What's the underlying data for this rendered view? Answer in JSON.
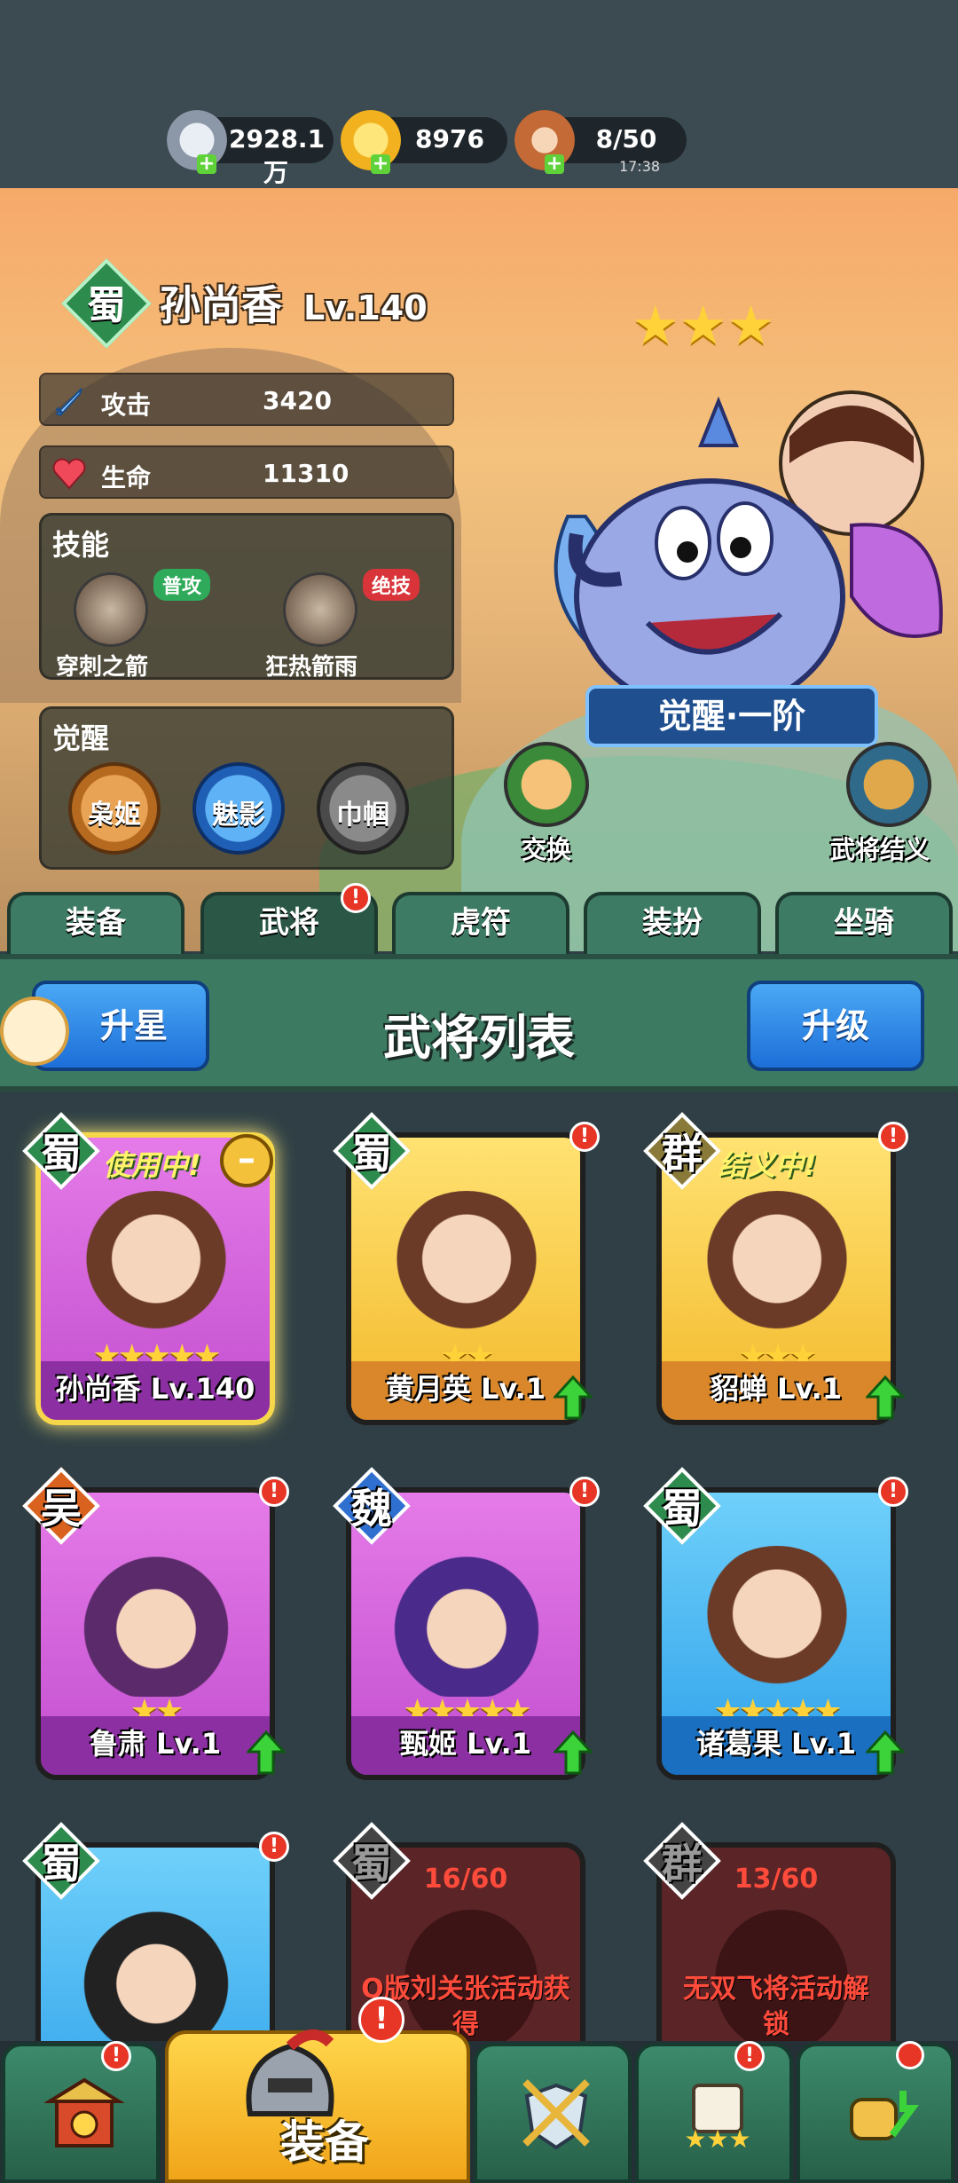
{
  "resources": {
    "silver": "2928.1万",
    "gold": "8976",
    "stamina": "8/50",
    "stamina_timer": "17:38",
    "plus": "+"
  },
  "hero": {
    "kingdom": "蜀",
    "name": "孙尚香",
    "level": "Lv.140",
    "stars": 5,
    "stats": [
      {
        "label": "攻击",
        "value": "3420"
      },
      {
        "label": "生命",
        "value": "11310"
      }
    ],
    "skills_title": "技能",
    "skills": [
      {
        "name": "穿刺之箭",
        "tag": "普攻"
      },
      {
        "name": "狂热箭雨",
        "tag": "绝技"
      }
    ],
    "awaken_title": "觉醒",
    "awakenings": [
      "枭姬",
      "魅影",
      "巾帼"
    ],
    "awaken_stage": "觉醒·一阶",
    "swap_label": "交换",
    "sworn_label": "武将结义"
  },
  "tabs": [
    "装备",
    "武将",
    "虎符",
    "装扮",
    "坐骑"
  ],
  "badge_mark": "!",
  "list": {
    "title": "武将列表",
    "star_up": "升星",
    "level_up": "升级"
  },
  "cards": [
    {
      "kingdom": "蜀",
      "name": "孙尚香",
      "level": "Lv.140",
      "stars": "★★★★★",
      "status": "使用中!",
      "label": "孙尚香 Lv.140"
    },
    {
      "kingdom": "蜀",
      "name": "黄月英",
      "level": "Lv.1",
      "stars": "★★",
      "label": "黄月英 Lv.1"
    },
    {
      "kingdom": "群",
      "name": "貂蝉",
      "level": "Lv.1",
      "stars": "★★★",
      "status": "结义中!",
      "label": "貂蝉 Lv.1"
    },
    {
      "kingdom": "吴",
      "name": "鲁肃",
      "level": "Lv.1",
      "stars": "★★",
      "label": "鲁肃 Lv.1"
    },
    {
      "kingdom": "魏",
      "name": "甄姬",
      "level": "Lv.1",
      "stars": "★★★★★",
      "label": "甄姬 Lv.1"
    },
    {
      "kingdom": "蜀",
      "name": "诸葛果",
      "level": "Lv.1",
      "stars": "★★★★★",
      "label": "诸葛果 Lv.1"
    },
    {
      "kingdom": "蜀",
      "name": "",
      "level": "",
      "stars": "",
      "label": ""
    },
    {
      "kingdom": "蜀",
      "progress": "16/60",
      "unlock": "Q版刘关张活动获得"
    },
    {
      "kingdom": "群",
      "progress": "13/60",
      "unlock": "无双飞将活动解锁"
    }
  ],
  "bottom_nav": {
    "main_label": "装备"
  },
  "colors": {
    "shu": "#2e8b4e",
    "wu": "#d9621f",
    "wei": "#2f6fd0",
    "qun": "#8a7a3a",
    "accent_blue": "#1d6fd8",
    "badge_red": "#e73526"
  }
}
